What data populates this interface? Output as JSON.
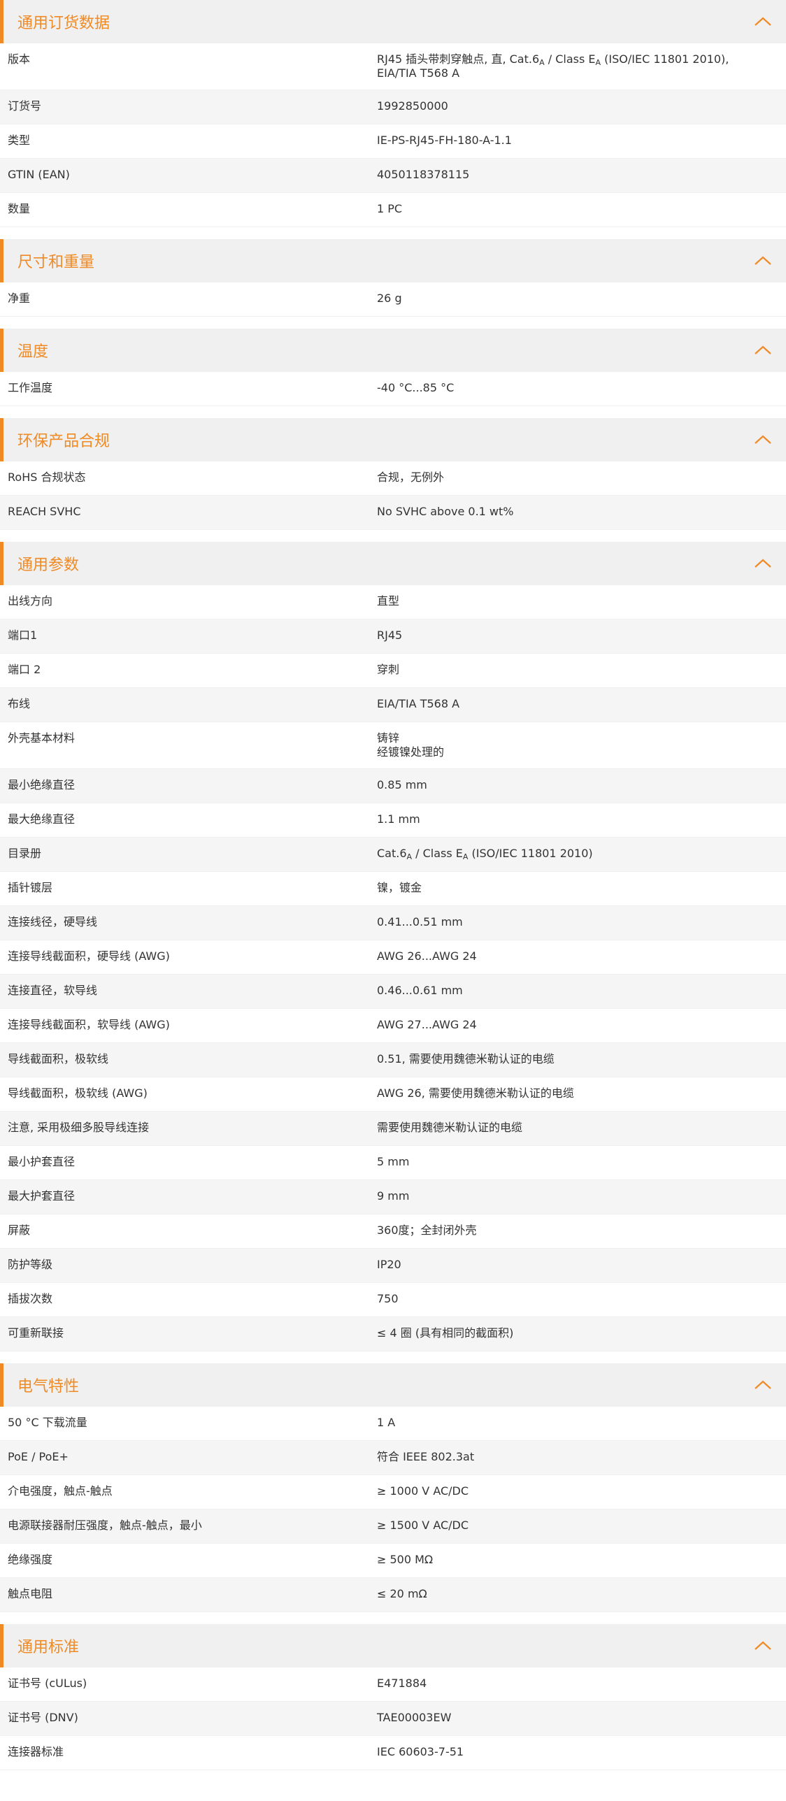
{
  "theme": {
    "accent": "#f08a24",
    "header_bg": "#f0f0f0",
    "alt_row_bg": "#f5f5f5"
  },
  "sections": [
    {
      "key": "general-ordering-data",
      "title": "通用订货数据",
      "icon": "chevron-up-icon",
      "rows": [
        {
          "label": "版本",
          "value": [
            [
              "RJ45 插头带刺穿触点, 直, Cat.6",
              ""
            ],
            [
              "A",
              "sub"
            ],
            [
              " / Class E",
              ""
            ],
            [
              "A",
              "sub"
            ],
            [
              " (ISO/IEC 11801 2010), EIA/TIA T568 A",
              ""
            ]
          ]
        },
        {
          "label": "订货号",
          "value": "1992850000"
        },
        {
          "label": "类型",
          "value": "IE-PS-RJ45-FH-180-A-1.1"
        },
        {
          "label": "GTIN (EAN)",
          "value": "4050118378115"
        },
        {
          "label": "数量",
          "value": "1  PC"
        }
      ]
    },
    {
      "key": "dimensions-weight",
      "title": "尺寸和重量",
      "icon": "chevron-up-icon",
      "rows": [
        {
          "label": "净重",
          "value": "26  g"
        }
      ]
    },
    {
      "key": "temperature",
      "title": "温度",
      "icon": "chevron-up-icon",
      "rows": [
        {
          "label": "工作温度",
          "value": "-40 °C...85 °C"
        }
      ]
    },
    {
      "key": "environmental-compliance",
      "title": "环保产品合规",
      "icon": "chevron-up-icon",
      "rows": [
        {
          "label": "RoHS 合规状态",
          "value": "合规，无例外"
        },
        {
          "label": "REACH SVHC",
          "value": "No SVHC above 0.1 wt%"
        }
      ]
    },
    {
      "key": "general-parameters",
      "title": "通用参数",
      "icon": "chevron-up-icon",
      "rows": [
        {
          "label": "出线方向",
          "value": "直型"
        },
        {
          "label": "端口1",
          "value": "RJ45"
        },
        {
          "label": "端口 2",
          "value": "穿刺"
        },
        {
          "label": "布线",
          "value": "EIA/TIA T568 A"
        },
        {
          "label": "外壳基本材料",
          "value": [
            "铸锌",
            "经镀镍处理的"
          ]
        },
        {
          "label": "最小绝缘直径",
          "value": "0.85  mm"
        },
        {
          "label": "最大绝缘直径",
          "value": "1.1  mm"
        },
        {
          "label": "目录册",
          "value": [
            [
              "Cat.6",
              ""
            ],
            [
              "A",
              "sub"
            ],
            [
              " / Class E",
              ""
            ],
            [
              "A",
              "sub"
            ],
            [
              " (ISO/IEC 11801 2010)",
              ""
            ]
          ]
        },
        {
          "label": "插针镀层",
          "value": "镍，镀金"
        },
        {
          "label": "连接线径，硬导线",
          "value": "0.41...0.51 mm"
        },
        {
          "label": "连接导线截面积，硬导线 (AWG)",
          "value": "AWG 26...AWG 24"
        },
        {
          "label": "连接直径，软导线",
          "value": "0.46...0.61 mm"
        },
        {
          "label": "连接导线截面积，软导线 (AWG)",
          "value": "AWG 27...AWG 24"
        },
        {
          "label": "导线截面积，极软线",
          "value": "0.51, 需要使用魏德米勒认证的电缆"
        },
        {
          "label": "导线截面积，极软线 (AWG)",
          "value": "AWG 26, 需要使用魏德米勒认证的电缆"
        },
        {
          "label": "注意, 采用极细多股导线连接",
          "value": "需要使用魏德米勒认证的电缆"
        },
        {
          "label": "最小护套直径",
          "value": "5  mm"
        },
        {
          "label": "最大护套直径",
          "value": "9  mm"
        },
        {
          "label": "屏蔽",
          "value": "360度；全封闭外壳"
        },
        {
          "label": "防护等级",
          "value": "IP20"
        },
        {
          "label": "插拔次数",
          "value": "750"
        },
        {
          "label": "可重新联接",
          "value": "≤ 4 圈 (具有相同的截面积)"
        }
      ]
    },
    {
      "key": "electrical-characteristics",
      "title": "电气特性",
      "icon": "chevron-up-icon",
      "rows": [
        {
          "label": "50 °C 下载流量",
          "value": "1  A"
        },
        {
          "label": "PoE / PoE+",
          "value": "符合 IEEE 802.3at"
        },
        {
          "label": "介电强度，触点-触点",
          "value": "≥ 1000 V AC/DC"
        },
        {
          "label": "电源联接器耐压强度，触点-触点，最小",
          "value": "≥ 1500 V AC/DC"
        },
        {
          "label": "绝缘强度",
          "value": "≥ 500 MΩ"
        },
        {
          "label": "触点电阻",
          "value": "≤ 20 mΩ"
        }
      ]
    },
    {
      "key": "general-standards",
      "title": "通用标准",
      "icon": "chevron-up-icon",
      "rows": [
        {
          "label": "证书号 (cULus)",
          "value": "E471884"
        },
        {
          "label": "证书号 (DNV)",
          "value": "TAE00003EW"
        },
        {
          "label": "连接器标准",
          "value": "IEC 60603-7-51"
        }
      ]
    }
  ]
}
